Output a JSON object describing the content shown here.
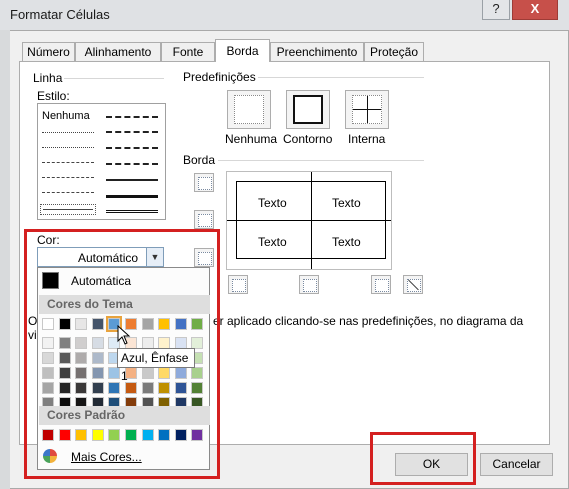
{
  "window": {
    "title": "Formatar Células",
    "help_label": "?",
    "close_label": "X"
  },
  "tabs": [
    {
      "label": "Número"
    },
    {
      "label": "Alinhamento"
    },
    {
      "label": "Fonte"
    },
    {
      "label": "Borda"
    },
    {
      "label": "Preenchimento"
    },
    {
      "label": "Proteção"
    }
  ],
  "linha": {
    "group_label": "Linha",
    "estilo_label": "Estilo:",
    "none_label": "Nenhuma",
    "cor_label": "Cor:",
    "color_value": "Automático"
  },
  "predefinicoes": {
    "group_label": "Predefinições",
    "items": [
      {
        "label": "Nenhuma"
      },
      {
        "label": "Contorno"
      },
      {
        "label": "Interna"
      }
    ]
  },
  "borda": {
    "group_label": "Borda",
    "preview_texts": [
      "Texto",
      "Texto",
      "Texto",
      "Texto"
    ]
  },
  "hint": {
    "prefix": "O",
    "text": "er aplicado clicando-se nas predefinições, no diagrama da",
    "line2": "vi"
  },
  "color_popup": {
    "automatic_label": "Automática",
    "theme_label": "Cores do Tema",
    "standard_label": "Cores Padrão",
    "more_label": "Mais Cores...",
    "tooltip": "Azul, Ênfase 1",
    "theme_colors": [
      "#ffffff",
      "#000000",
      "#e7e6e6",
      "#44546a",
      "#5b9bd5",
      "#ed7d31",
      "#a5a5a5",
      "#ffc000",
      "#4472c4",
      "#70ad47"
    ],
    "theme_shades": [
      [
        "#f2f2f2",
        "#808080",
        "#d0cece",
        "#d6dce4",
        "#deebf6",
        "#fbe5d5",
        "#ededed",
        "#fff2cc",
        "#d9e2f3",
        "#e2efd9"
      ],
      [
        "#d8d8d8",
        "#595959",
        "#aeabab",
        "#adb9ca",
        "#bdd7ee",
        "#f7cbac",
        "#dbdbdb",
        "#fee599",
        "#b4c6e7",
        "#c5e0b3"
      ],
      [
        "#bfbfbf",
        "#3f3f3f",
        "#757070",
        "#8496b0",
        "#9cc3e5",
        "#f4b183",
        "#c9c9c9",
        "#ffd965",
        "#8eaadb",
        "#a8d08d"
      ],
      [
        "#a5a5a5",
        "#262626",
        "#3a3838",
        "#323f4f",
        "#2e75b5",
        "#c55a11",
        "#7b7b7b",
        "#bf9000",
        "#2f5496",
        "#538135"
      ],
      [
        "#7f7f7f",
        "#0c0c0c",
        "#171616",
        "#222a35",
        "#1e4e79",
        "#833c0b",
        "#525252",
        "#7f6000",
        "#1f3864",
        "#375623"
      ]
    ],
    "standard_colors": [
      "#c00000",
      "#ff0000",
      "#ffc000",
      "#ffff00",
      "#92d050",
      "#00b050",
      "#00b0f0",
      "#0070c0",
      "#002060",
      "#7030a0"
    ]
  },
  "buttons": {
    "ok_label": "OK",
    "cancel_label": "Cancelar"
  },
  "highlight_color": "#d42020"
}
